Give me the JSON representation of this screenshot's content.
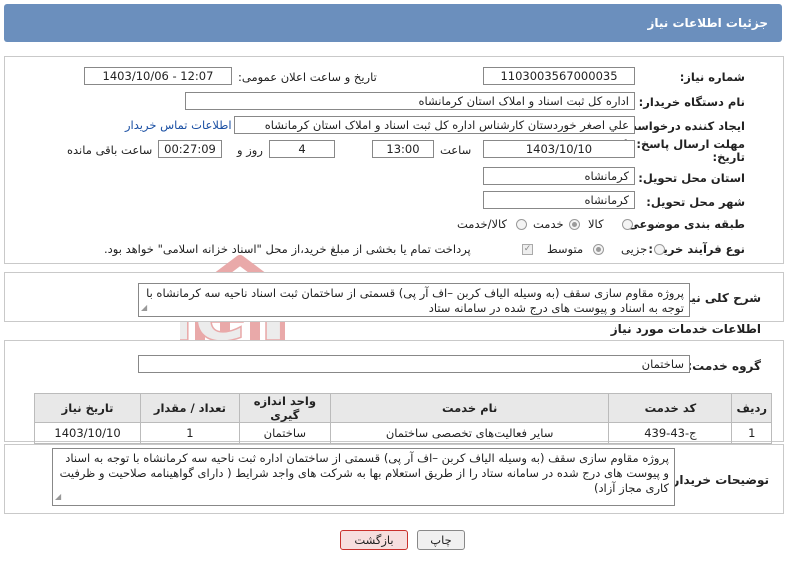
{
  "header": {
    "title": "جزئیات اطلاعات نیاز"
  },
  "form": {
    "need_number_label": "شماره نیاز:",
    "need_number": "1103003567000035",
    "announce_label": "تاریخ و ساعت اعلان عمومی:",
    "announce_value": "1403/10/06 - 12:07",
    "buyer_org_label": "نام دستگاه خریدار:",
    "buyer_org": "اداره کل ثبت اسناد و املاک استان کرمانشاه",
    "requester_label": "ایجاد کننده درخواست:",
    "requester": "علي اصغر خوردستان كارشناس اداره کل ثبت اسناد و املاک استان کرمانشاه",
    "contact_link": "اطلاعات تماس خریدار",
    "deadline_label": "مهلت ارسال پاسخ: تا",
    "deadline_label2": "تاریخ:",
    "deadline_date": "1403/10/10",
    "time_label": "ساعت",
    "deadline_time": "13:00",
    "days": "4",
    "days_label": "روز و",
    "remaining_time": "00:27:09",
    "remaining_label": "ساعت باقی مانده",
    "province_label": "استان محل تحویل:",
    "province": "کرمانشاه",
    "city_label": "شهر محل تحویل:",
    "city": "کرمانشاه",
    "category_label": "طبقه بندی موضوعی:",
    "category_options": [
      "کالا",
      "خدمت",
      "کالا/خدمت"
    ],
    "category_selected": "خدمت",
    "process_label": "نوع فرآیند خرید :",
    "process_options": [
      "جزیی",
      "متوسط"
    ],
    "process_selected": "متوسط",
    "payment_note": "پرداخت تمام یا بخشی از مبلغ خرید،از محل \"اسناد خزانه اسلامی\" خواهد بود."
  },
  "need_summary": {
    "label": "شرح کلی نیاز:",
    "text": "پروژه مقاوم سازی سقف (به وسیله الیاف کربن –اف آر پی) قسمتی از ساختمان ثبت اسناد ناحیه سه کرمانشاه با توجه به اسناد و پیوست های درج شده در سامانه ستاد"
  },
  "services": {
    "section_title": "اطلاعات خدمات مورد نیاز",
    "group_label": "گروه خدمت:",
    "group_value": "ساختمان",
    "columns": [
      "ردیف",
      "کد خدمت",
      "نام خدمت",
      "واحد اندازه گیری",
      "تعداد / مقدار",
      "تاریخ نیاز"
    ],
    "rows": [
      [
        "1",
        "ج-43-439",
        "سایر فعالیت‌های تخصصی ساختمان",
        "ساختمان",
        "1",
        "1403/10/10"
      ]
    ]
  },
  "buyer_notes": {
    "label": "توضیحات خریدار:",
    "text": "پروژه مقاوم سازی سقف (به وسیله الیاف کربن –اف آر پی) قسمتی از ساختمان اداره ثبت ناحیه سه کرمانشاه با توجه به اسناد و پیوست های درج شده در سامانه ستاد را از طریق استعلام بها به شرکت های واجد شرایط ( دارای گواهینامه صلاحیت و ظرفیت کاری مجاز آزاد)"
  },
  "buttons": {
    "print": "چاپ",
    "back": "بازگشت"
  },
  "watermark": {
    "text": "AriaTender.neT"
  },
  "colors": {
    "header": "#6b8fbd",
    "link": "#1a4fa3",
    "watermark": "#e9a9a9"
  }
}
